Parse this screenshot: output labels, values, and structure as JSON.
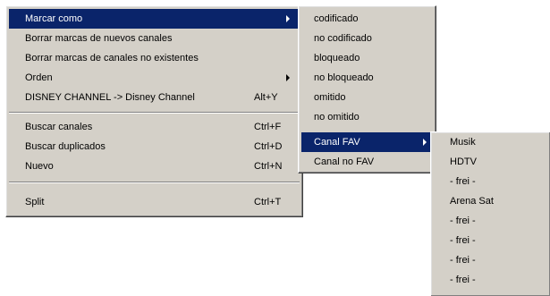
{
  "menu_main": {
    "items": [
      {
        "label": "Marcar como",
        "accel": "",
        "submenu": true,
        "highlighted": true
      },
      {
        "label": "Borrar marcas de nuevos canales",
        "accel": "",
        "submenu": false
      },
      {
        "label": "Borrar marcas de canales no existentes",
        "accel": "",
        "submenu": false
      },
      {
        "label": "Orden",
        "accel": "",
        "submenu": true
      },
      {
        "label": "DISNEY CHANNEL -> Disney Channel",
        "accel": "Alt+Y",
        "submenu": false
      },
      {
        "label": "Buscar canales",
        "accel": "Ctrl+F",
        "submenu": false
      },
      {
        "label": "Buscar duplicados",
        "accel": "Ctrl+D",
        "submenu": false
      },
      {
        "label": "Nuevo",
        "accel": "Ctrl+N",
        "submenu": false
      },
      {
        "label": "Split",
        "accel": "Ctrl+T",
        "submenu": false
      }
    ]
  },
  "menu_mark": {
    "items": [
      {
        "label": "codificado"
      },
      {
        "label": "no codificado"
      },
      {
        "label": "bloqueado"
      },
      {
        "label": "no bloqueado"
      },
      {
        "label": "omitido"
      },
      {
        "label": "no omitido"
      },
      {
        "label": "Canal FAV",
        "submenu": true,
        "highlighted": true
      },
      {
        "label": "Canal no FAV"
      }
    ]
  },
  "menu_fav": {
    "items": [
      {
        "label": "Musik"
      },
      {
        "label": "HDTV"
      },
      {
        "label": "- frei -"
      },
      {
        "label": "Arena Sat"
      },
      {
        "label": "- frei -"
      },
      {
        "label": "- frei -"
      },
      {
        "label": "- frei -"
      },
      {
        "label": "- frei -"
      }
    ]
  },
  "colors": {
    "menu_bg": "#d4d0c8",
    "highlight": "#0a246a",
    "highlight_text": "#ffffff"
  }
}
